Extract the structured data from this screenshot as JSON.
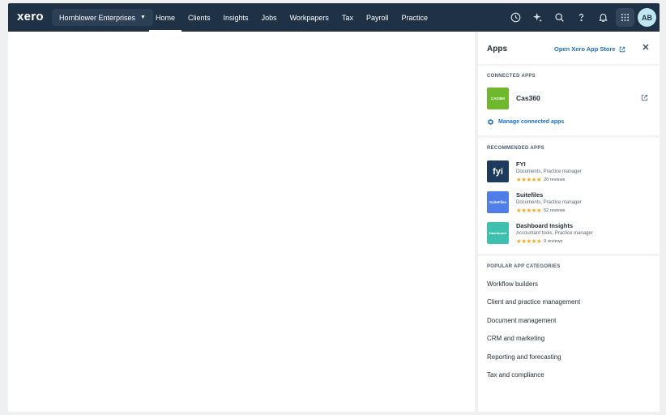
{
  "topbar": {
    "logo": "xero",
    "org_name": "Hornblower Enterprises",
    "nav": [
      "Home",
      "Clients",
      "Insights",
      "Jobs",
      "Workpapers",
      "Tax",
      "Payroll",
      "Practice"
    ],
    "active_nav": "Home",
    "icons": [
      "clock-icon",
      "sparkle-icon",
      "search-icon",
      "help-icon",
      "bell-icon",
      "app-grid-icon"
    ],
    "avatar_initials": "AB"
  },
  "panel": {
    "title": "Apps",
    "store_link": "Open Xero App Store",
    "connected": {
      "label": "CONNECTED APPS",
      "app_name": "Cas360",
      "logo_text": "CAS360",
      "manage_label": "Manage connected apps"
    },
    "recommended": {
      "label": "RECOMMENDED APPS",
      "items": [
        {
          "name": "FYI",
          "categories": "Documents, Practice manager",
          "rating": 5,
          "reviews": "20 reviews",
          "logo_text": "fyi",
          "logo_color": "#1d3b5c"
        },
        {
          "name": "Suitefiles",
          "categories": "Documents, Practice manager",
          "rating": 5,
          "reviews": "52 reviews",
          "logo_text": "SuiteFiles",
          "logo_color": "#4f7ee8"
        },
        {
          "name": "Dashboard Insights",
          "categories": "Accountant tools, Practice manager",
          "rating": 5,
          "reviews": "9 reviews",
          "logo_text": "Dashboard",
          "logo_color": "#3fbfae"
        }
      ]
    },
    "categories": {
      "label": "POPULAR APP CATEGORIES",
      "items": [
        "Workflow builders",
        "Client and practice management",
        "Document management",
        "CRM and marketing",
        "Reporting and forecasting",
        "Tax and compliance"
      ]
    }
  }
}
